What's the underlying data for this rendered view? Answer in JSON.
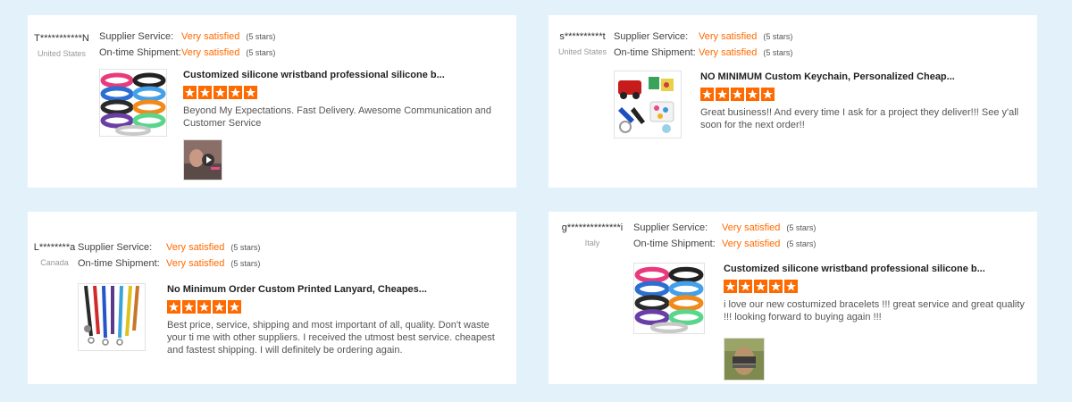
{
  "labels": {
    "supplier_service": "Supplier Service:",
    "on_time_shipment": "On-time Shipment:"
  },
  "colors": {
    "page_background": "#e3f1fb",
    "card_background": "#ffffff",
    "rating_text": "#ff6a00",
    "star": "#ff6a00"
  },
  "reviews": [
    {
      "buyer": "T***********N",
      "country": "United States",
      "supplier_service": "Very satisfied",
      "supplier_service_stars": "(5 stars)",
      "on_time_shipment": "Very satisfied",
      "on_time_shipment_stars": "(5 stars)",
      "product_title": "Customized silicone wristband professional silicone b...",
      "product_icon": "wristband-product-image",
      "rating": 5,
      "comment": "Beyond My Expectations. Fast Delivery. Awesome Communication and Customer Service",
      "has_photo": true
    },
    {
      "buyer": "s**********t",
      "country": "United States",
      "supplier_service": "Very satisfied",
      "supplier_service_stars": "(5 stars)",
      "on_time_shipment": "Very satisfied",
      "on_time_shipment_stars": "(5 stars)",
      "product_title": "NO MINIMUM Custom Keychain, Personalized Cheap...",
      "product_icon": "keychain-product-image",
      "rating": 5,
      "comment": "Great business!! And every time I ask for a project they deliver!!! See y'all soon for the next order!!",
      "has_photo": false
    },
    {
      "buyer": "L********a",
      "country": "Canada",
      "supplier_service": "Very satisfied",
      "supplier_service_stars": "(5 stars)",
      "on_time_shipment": "Very satisfied",
      "on_time_shipment_stars": "(5 stars)",
      "product_title": "No Minimum Order Custom Printed Lanyard, Cheapes...",
      "product_icon": "lanyard-product-image",
      "rating": 5,
      "comment": "Best price, service, shipping and most important of all, quality. Don't waste your ti me with other suppliers. I received the utmost best service. cheapest and fastest shipping. I will definitely be ordering again.",
      "has_photo": false
    },
    {
      "buyer": "g**************i",
      "country": "Italy",
      "supplier_service": "Very satisfied",
      "supplier_service_stars": "(5 stars)",
      "on_time_shipment": "Very satisfied",
      "on_time_shipment_stars": "(5 stars)",
      "product_title": "Customized silicone wristband professional silicone b...",
      "product_icon": "wristband-product-image",
      "rating": 5,
      "comment": "i love our new costumized bracelets !!! great service and great quality !!! looking forward to buying again !!!",
      "has_photo": true
    }
  ]
}
